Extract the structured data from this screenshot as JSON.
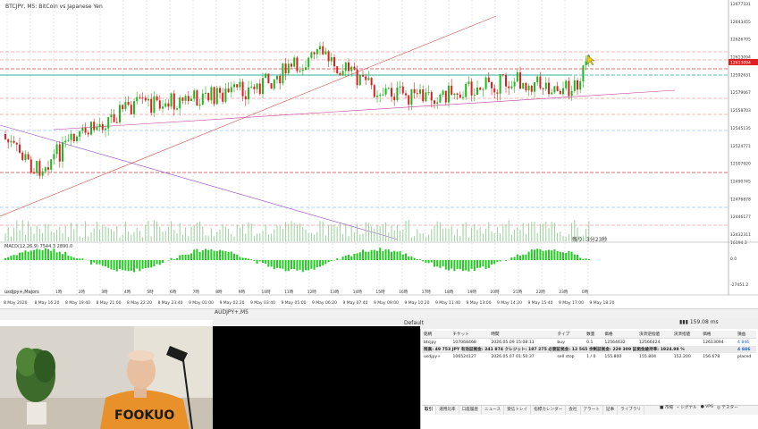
{
  "chart": {
    "title": "BTCJPY, M5: BitCoin vs Japanese Yen",
    "overlay_text": "残り: 3分23秒",
    "macd_label": "MACD(12,26,9) 7544.3 2890.0",
    "symbol_tag": "usdjpy+,Majors",
    "price_levels": [
      "12677331",
      "12643455",
      "12626705",
      "12613094",
      "12592631",
      "12579067",
      "12558703",
      "12545135",
      "12524771",
      "12507920",
      "12490745",
      "12476878",
      "12446177",
      "12432311"
    ],
    "current_price": "12613094",
    "macd_levels": [
      "16194.3",
      "0.0",
      "-27451.2"
    ],
    "time_labels": [
      "8 May 2026",
      "8 May 16:20",
      "8 May 19:40",
      "8 May 21:00",
      "8 May 22:20",
      "8 May 23:40",
      "9 May 01:00",
      "9 May 02:20",
      "9 May 03:40",
      "9 May 05:00",
      "9 May 06:20",
      "9 May 07:40",
      "9 May 09:00",
      "9 May 10:20",
      "9 May 11:40",
      "9 May 13:00",
      "9 May 14:20",
      "9 May 15:40",
      "9 May 17:00",
      "9 May 18:20"
    ],
    "hour_labels": [
      "1時",
      "2時",
      "3時",
      "4時",
      "5時",
      "6時",
      "7時",
      "8時",
      "9時",
      "10時",
      "11時",
      "12時",
      "13時",
      "14時",
      "15時",
      "16時",
      "17時",
      "18時",
      "19時",
      "20時",
      "21時",
      "22時",
      "23時",
      "0時"
    ],
    "colors": {
      "bull": "#1fb81f",
      "bear": "#e02020",
      "grid": "#e4e4e4"
    }
  },
  "chart_tab": "AUDJPY+,M5",
  "ping": "159.08 ms",
  "toolbox": {
    "title": "Default",
    "headers": [
      "銘柄",
      "チケット",
      "時間",
      "タイプ",
      "数量",
      "価格",
      "決済逆指値",
      "決済指値",
      "価格",
      "損益"
    ],
    "rows": [
      [
        "btcjpy",
        "107068468",
        "2026.05.09 15:08:11",
        "buy",
        "0.1",
        "12564632",
        "12566424",
        "",
        "12613094",
        "4 846"
      ],
      [
        "usdjpy+",
        "106524127",
        "2026.05.07 01:50:37",
        "sell stop",
        "1 / 0",
        "155.800",
        "155.804",
        "152.200",
        "156.678",
        "placed"
      ]
    ],
    "summary": "残高: 49 753 JPY  有効証拠金: 241 874  クレジット: 187 275  必要証拠金: 12 565  余剰証拠金: 229 309  証拠金維持率: 1924.98 %",
    "summary_profit": "4 846",
    "tabs": [
      "取引",
      "運用比率",
      "口座履歴",
      "ニュース",
      "受信トレイ",
      "指標カレンダー",
      "会社",
      "アラート",
      "記事",
      "ライブラリ"
    ],
    "right_tools": [
      "市場",
      "シグナル",
      "VPS",
      "テスター"
    ]
  }
}
